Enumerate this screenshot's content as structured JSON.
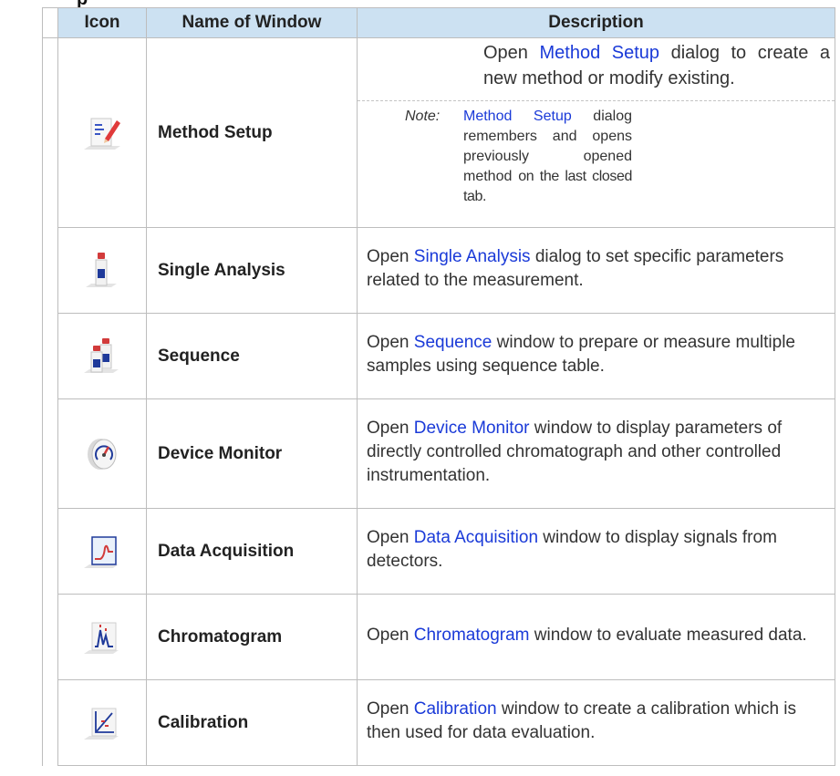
{
  "heading_fragment": "p",
  "table": {
    "headers": {
      "icon": "Icon",
      "name": "Name of Window",
      "description": "Description"
    },
    "rows": [
      {
        "icon": "method-setup-icon",
        "name": "Method Setup",
        "desc_pre": "Open ",
        "desc_link": "Method Setup",
        "desc_post": " dialog to create a new method or modify existing.",
        "note_label": "Note:",
        "note_link": "Method Setup",
        "note_mid": " dialog remembers and opens previously opened method",
        "note_last": "on the last closed tab."
      },
      {
        "icon": "single-analysis-icon",
        "name": "Single Analysis",
        "desc_pre": "Open ",
        "desc_link": "Single Analysis",
        "desc_post": " dialog to set specific parameters related to the measurement."
      },
      {
        "icon": "sequence-icon",
        "name": "Sequence",
        "desc_pre": "Open ",
        "desc_link": "Sequence",
        "desc_post": " window to prepare or measure multiple samples using sequence table."
      },
      {
        "icon": "device-monitor-icon",
        "name": "Device Monitor",
        "desc_pre": "Open ",
        "desc_link": "Device Monitor",
        "desc_post": " window to display parameters of directly controlled chromatograph and other controlled instrumentation."
      },
      {
        "icon": "data-acquisition-icon",
        "name": "Data Acquisition",
        "desc_pre": "Open ",
        "desc_link": "Data Acquisition",
        "desc_post": " window to display signals from detectors."
      },
      {
        "icon": "chromatogram-icon",
        "name": "Chromatogram",
        "desc_pre": "Open ",
        "desc_link": "Chromatogram",
        "desc_post": " window to evaluate measured data."
      },
      {
        "icon": "calibration-icon",
        "name": "Calibration",
        "desc_pre": "Open ",
        "desc_link": "Calibration",
        "desc_post": " window to create a calibration which is then used for data evaluation."
      }
    ]
  }
}
